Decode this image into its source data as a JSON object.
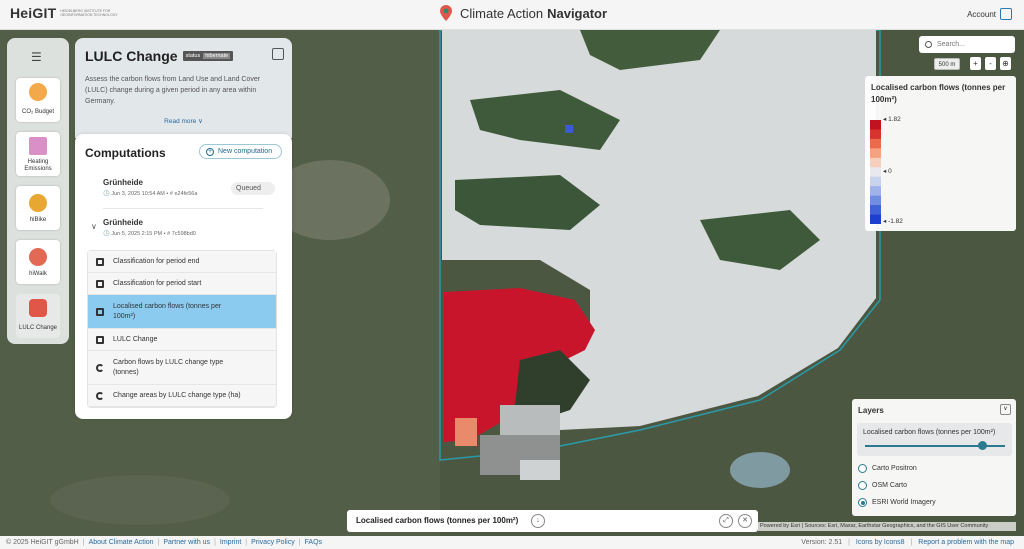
{
  "header": {
    "logo": "HeiGIT",
    "logo_sub": "HEIDELBERG INSTITUTE FOR GEOINFORMATION TECHNOLOGY",
    "app_title_prefix": "Climate Action",
    "app_title_bold": "Navigator",
    "account_label": "Account"
  },
  "rail": {
    "items": [
      {
        "label": "CO₂ Budget",
        "icon": "hourglass-icon"
      },
      {
        "label": "Heating Emissions",
        "icon": "radiator-icon"
      },
      {
        "label": "hiBike",
        "icon": "bike-icon"
      },
      {
        "label": "hiWalk",
        "icon": "walk-icon"
      },
      {
        "label": "LULC Change",
        "icon": "lulc-icon"
      }
    ]
  },
  "description": {
    "title": "LULC Change",
    "status_label": "status",
    "status_value": "hibernate",
    "text": "Assess the carbon flows from Land Use and Land Cover (LULC) change during a given period in any area within Germany.",
    "read_more": "Read more ∨"
  },
  "computations": {
    "title": "Computations",
    "new_button": "New computation",
    "runs": [
      {
        "name": "Grünheide",
        "meta": "🕓 Jun 3, 2025 10:54 AM • # e24fe56a",
        "status": "Queued"
      },
      {
        "name": "Grünheide",
        "meta": "🕓 Jun 5, 2025 2:15 PM • # 7c598bd0"
      }
    ],
    "results": [
      {
        "label": "Classification for period end",
        "icon": "image-icon"
      },
      {
        "label": "Classification for period start",
        "icon": "image-icon"
      },
      {
        "label": "Localised carbon flows (tonnes per 100m²)",
        "icon": "image-icon",
        "selected": true
      },
      {
        "label": "LULC Change",
        "icon": "image-icon"
      },
      {
        "label": "Carbon flows by LULC change type (tonnes)",
        "icon": "chart-icon"
      },
      {
        "label": "Change areas by LULC change type (ha)",
        "icon": "chart-icon"
      }
    ]
  },
  "map": {
    "search_placeholder": "Search...",
    "scale": "500 m",
    "zoom_in": "+",
    "zoom_out": "-"
  },
  "legend": {
    "title": "Localised carbon flows (tonnes per 100m²)",
    "max": "◂ 1.82",
    "mid": "◂ 0",
    "min": "◂ -1.82",
    "colors": [
      "#c1121f",
      "#d8342f",
      "#ec6a4c",
      "#f4a27f",
      "#f7d0bd",
      "#e8e8ee",
      "#c8d3ee",
      "#9fb3ea",
      "#6f8ee0",
      "#3f62d6",
      "#1d3fd0"
    ]
  },
  "layers": {
    "title": "Layers",
    "toggle": "∨",
    "active_layer": "Localised carbon flows (tonnes per 100m²)",
    "opacity": 0.95,
    "basemaps": [
      {
        "label": "Carto Positron",
        "selected": false
      },
      {
        "label": "OSM Carto",
        "selected": false
      },
      {
        "label": "ESRI World Imagery",
        "selected": true
      }
    ]
  },
  "bottom_bar": {
    "title": "Localised carbon flows (tonnes per 100m²)"
  },
  "attribution": "Powered by Esri | Sources: Esri, Maxar, Earthstar Geographics, and the GIS User Community",
  "footer": {
    "copyright": "© 2025 HeiGIT gGmbH",
    "links": [
      "About Climate Action",
      "Partner with us",
      "Imprint",
      "Privacy Policy",
      "FAQs"
    ],
    "version": "Version: 2.51",
    "icons_credit": "Icons by Icons8",
    "report": "Report a problem with the map"
  }
}
